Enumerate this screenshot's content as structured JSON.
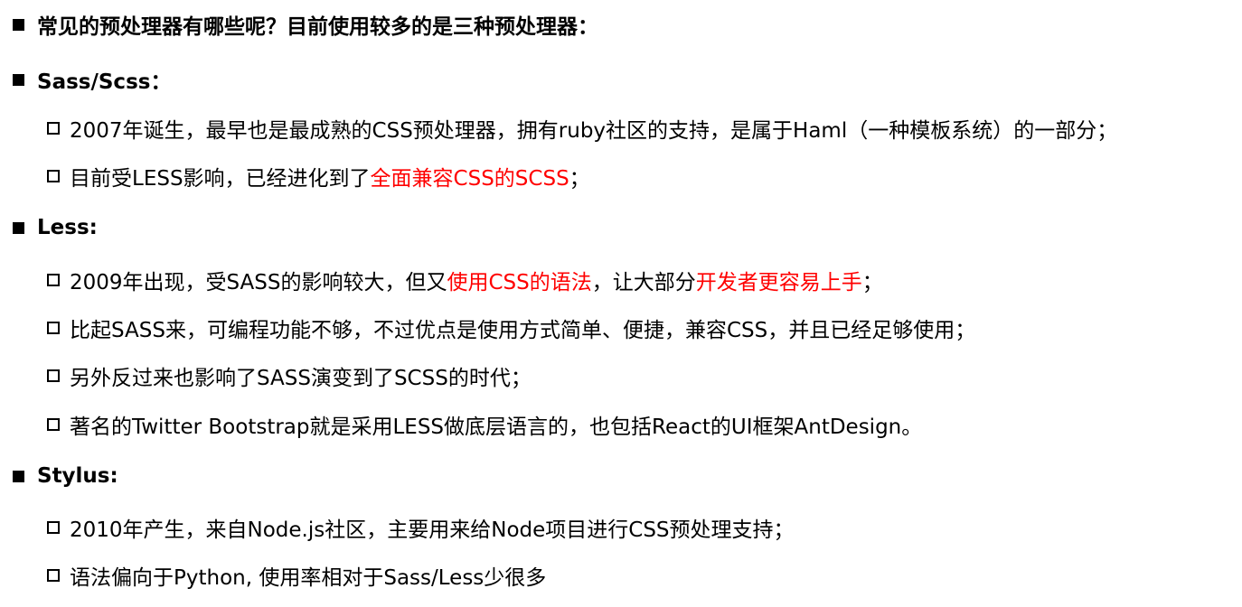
{
  "heading": {
    "text": "常见的预处理器有哪些呢？目前使用较多的是三种预处理器："
  },
  "colors": {
    "emphasis": "#ff0000",
    "text": "#000000"
  },
  "sections": [
    {
      "title": "Sass/Scss：",
      "items": [
        {
          "parts": [
            {
              "text": "2007年诞生，最早也是最成熟的CSS预处理器，拥有ruby社区的支持，是属于Haml（一种模板系统）的一部分；"
            }
          ]
        },
        {
          "parts": [
            {
              "text": "目前受LESS影响，已经进化到了"
            },
            {
              "text": "全面兼容CSS的SCSS"
            },
            {
              "text": "；"
            }
          ]
        }
      ]
    },
    {
      "title": "Less:",
      "items": [
        {
          "parts": [
            {
              "text": "2009年出现，受SASS的影响较大，但又"
            },
            {
              "text": "使用CSS的语法"
            },
            {
              "text": "，让大部分"
            },
            {
              "text": "开发者更容易上手"
            },
            {
              "text": "；"
            }
          ]
        },
        {
          "parts": [
            {
              "text": "比起SASS来，可编程功能不够，不过优点是使用方式简单、便捷，兼容CSS，并且已经足够使用；"
            }
          ]
        },
        {
          "parts": [
            {
              "text": "另外反过来也影响了SASS演变到了SCSS的时代；"
            }
          ]
        },
        {
          "parts": [
            {
              "text": "著名的Twitter Bootstrap就是采用LESS做底层语言的，也包括React的UI框架AntDesign。"
            }
          ]
        }
      ]
    },
    {
      "title": "Stylus:",
      "items": [
        {
          "parts": [
            {
              "text": "2010年产生，来自Node.js社区，主要用来给Node项目进行CSS预处理支持；"
            }
          ]
        },
        {
          "parts": [
            {
              "text": "语法偏向于Python, 使用率相对于Sass/Less少很多"
            }
          ]
        }
      ]
    }
  ]
}
